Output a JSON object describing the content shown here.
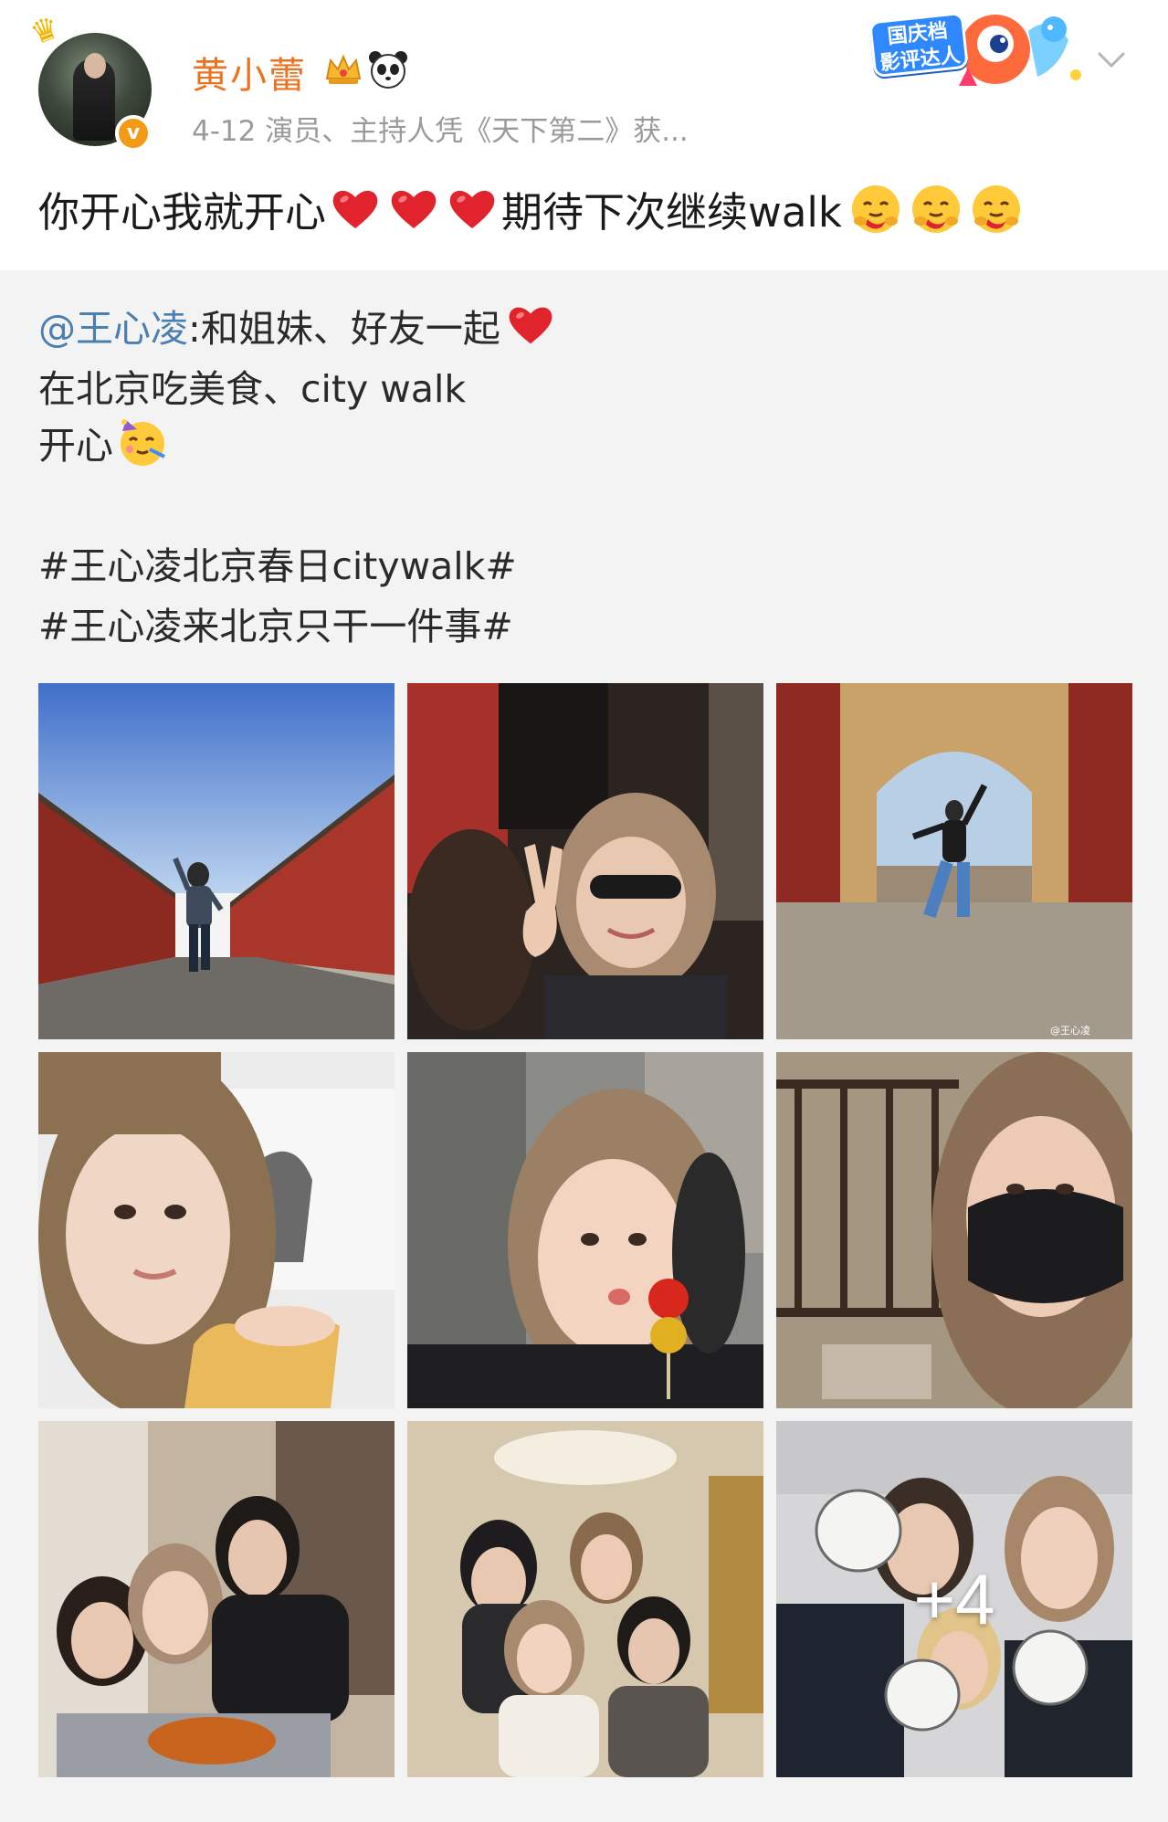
{
  "post": {
    "username": "黄小蕾",
    "meta": "4-12  演员、主持人凭《天下第二》获...",
    "promo_badge": "国庆档\n影评达人",
    "text_part1": "你开心我就开心",
    "text_part2": "期待下次继续walk"
  },
  "repost": {
    "mention": "@王心凌",
    "line1_rest": ":和姐妹、好友一起",
    "line2": "在北京吃美食、city walk",
    "line3": "开心",
    "hashtag1": "#王心凌北京春日citywalk#",
    "hashtag2": "#王心凌来北京只干一件事#"
  },
  "photos": [
    {
      "name": "photo-palace-wall-walk"
    },
    {
      "name": "photo-peace-sign-selfie"
    },
    {
      "name": "photo-archway-jump"
    },
    {
      "name": "photo-noodle-selfie"
    },
    {
      "name": "photo-candied-haws-selfie"
    },
    {
      "name": "photo-masked-selfie"
    },
    {
      "name": "photo-roast-duck-group"
    },
    {
      "name": "photo-restaurant-group"
    },
    {
      "name": "photo-bowls-group",
      "more_label": "+4"
    }
  ],
  "watermark_text": "@王心凌",
  "icons": [
    "crown-icon",
    "panda-icon",
    "verified-icon",
    "chevron-down-icon",
    "heart-emoji",
    "hug-face-emoji",
    "party-face-emoji"
  ]
}
